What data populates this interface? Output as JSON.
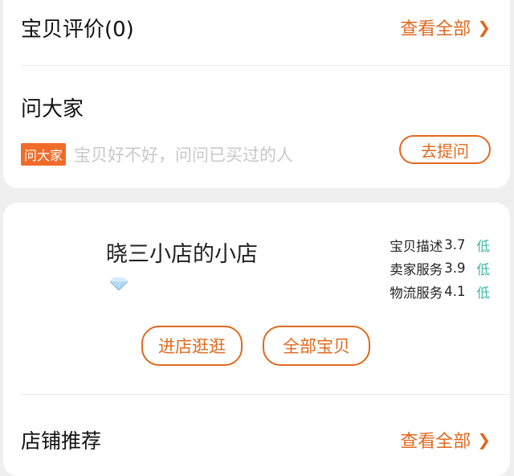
{
  "reviews": {
    "title": "宝贝评价(0)",
    "view_all": "查看全部"
  },
  "ask": {
    "title": "问大家",
    "badge": "问大家",
    "placeholder": "宝贝好不好，问问已买过的人",
    "button": "去提问"
  },
  "shop": {
    "name": "晓三小店的小店",
    "badge_icon": "diamond-icon",
    "ratings": [
      {
        "label": "宝贝描述",
        "score": "3.7",
        "level": "低"
      },
      {
        "label": "卖家服务",
        "score": "3.9",
        "level": "低"
      },
      {
        "label": "物流服务",
        "score": "4.1",
        "level": "低"
      }
    ],
    "enter_button": "进店逛逛",
    "all_items_button": "全部宝贝"
  },
  "recommend": {
    "title": "店铺推荐",
    "view_all": "查看全部"
  },
  "colors": {
    "accent": "#e0691e",
    "badge": "#f06b2a",
    "rating_level": "#3bb7a7",
    "background": "#efefef"
  }
}
